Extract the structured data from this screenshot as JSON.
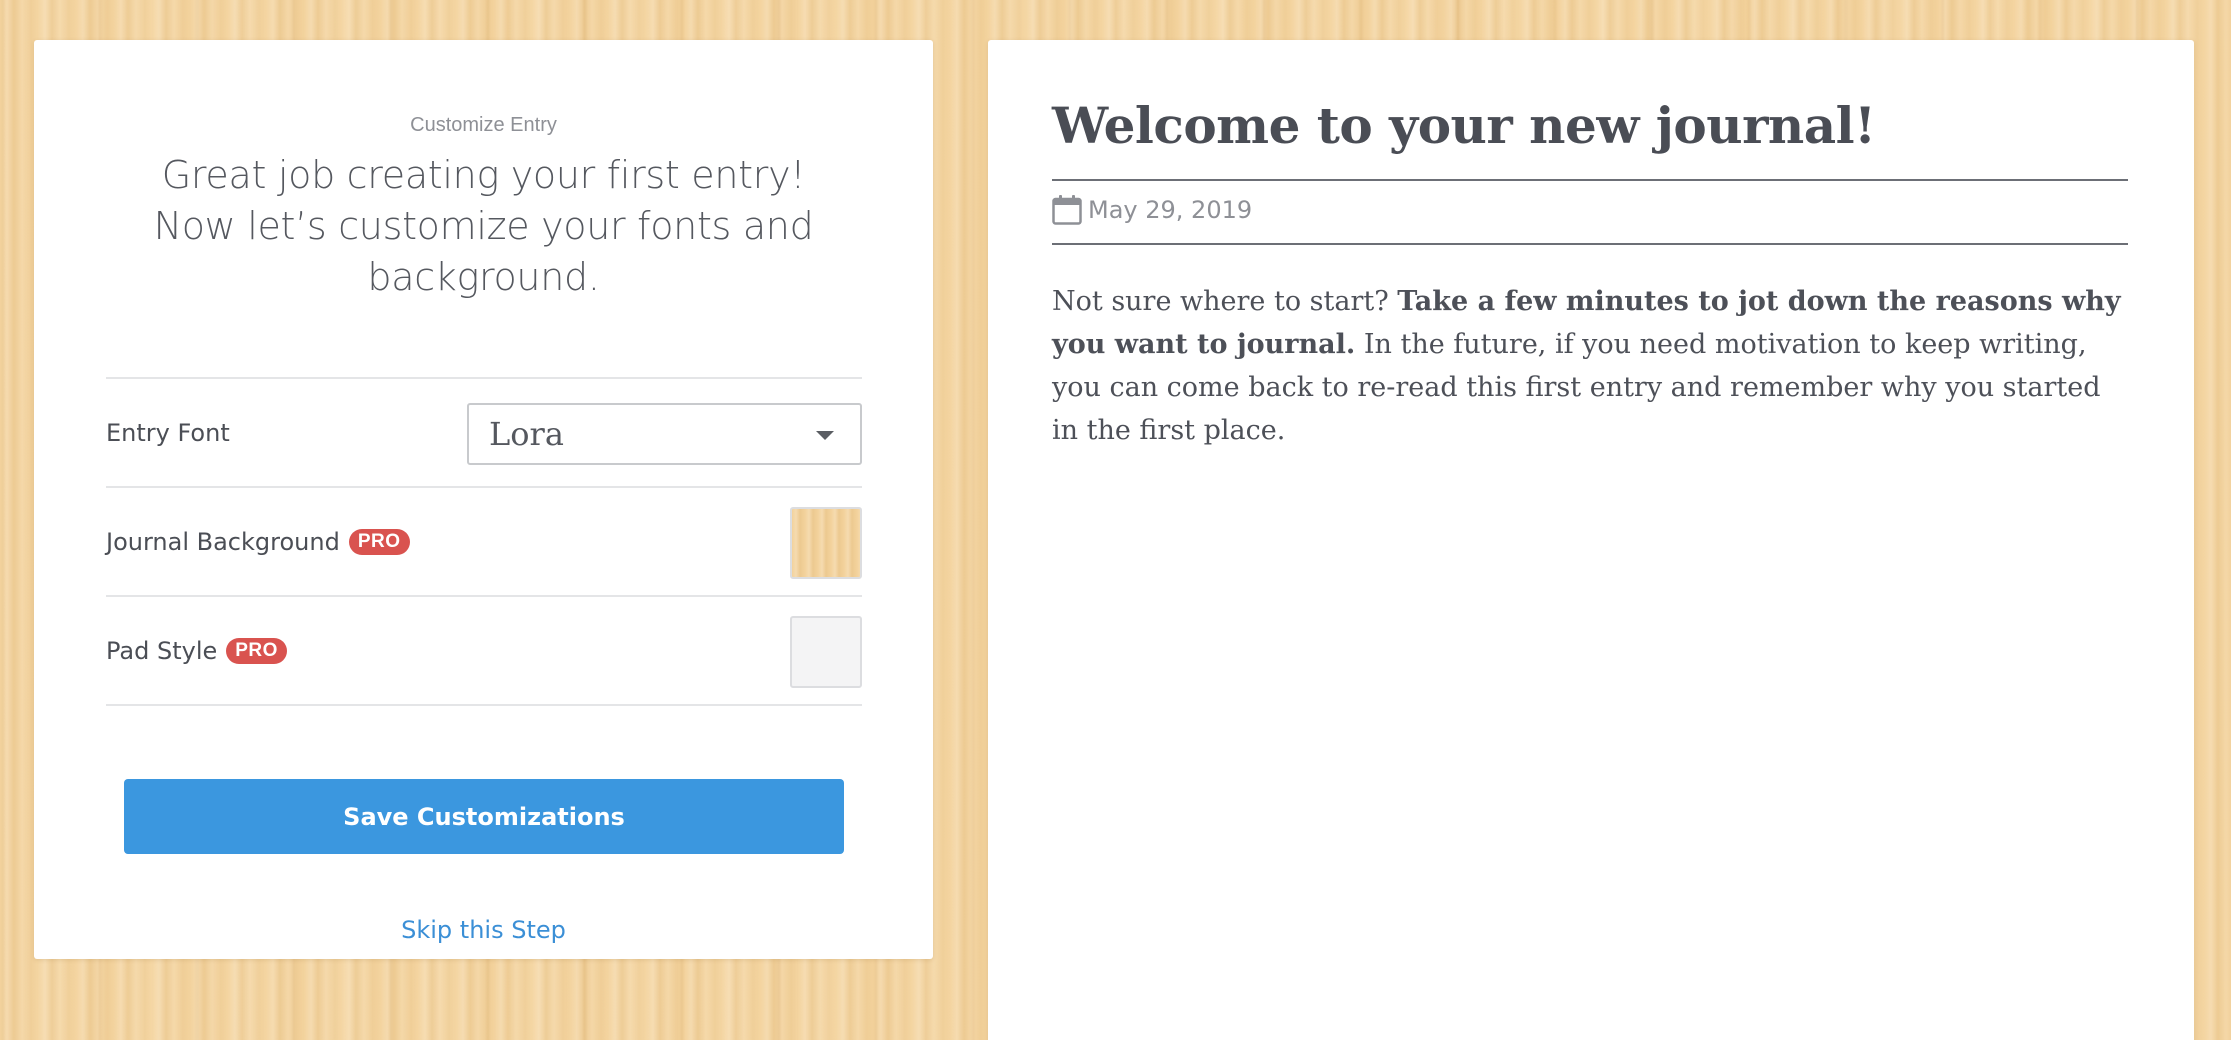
{
  "customize": {
    "eyebrow": "Customize Entry",
    "headline": "Great job creating your first entry! Now let’s customize your fonts and background.",
    "settings": [
      {
        "label": "Entry Font",
        "control": "select",
        "value": "Lora"
      },
      {
        "label": "Journal Background",
        "badge": "PRO",
        "control": "swatch",
        "swatch": "wood"
      },
      {
        "label": "Pad Style",
        "badge": "PRO",
        "control": "swatch",
        "swatch": "pad"
      }
    ],
    "save_label": "Save Customizations",
    "skip_label": "Skip this Step"
  },
  "entry": {
    "title": "Welcome to your new journal!",
    "date": "May 29, 2019",
    "body_intro": "Not sure where to start? ",
    "body_bold": "Take a few minutes to jot down the reasons why you want to journal.",
    "body_rest": " In the future, if you need motivation to keep writing, you can come back to re-read this first entry and remember why you started in the first place."
  },
  "colors": {
    "accent": "#3b97df",
    "pro_badge": "#d9534f",
    "background": "#f3d29c"
  },
  "icons": {
    "date": "calendar-icon",
    "select": "chevron-down-icon"
  }
}
